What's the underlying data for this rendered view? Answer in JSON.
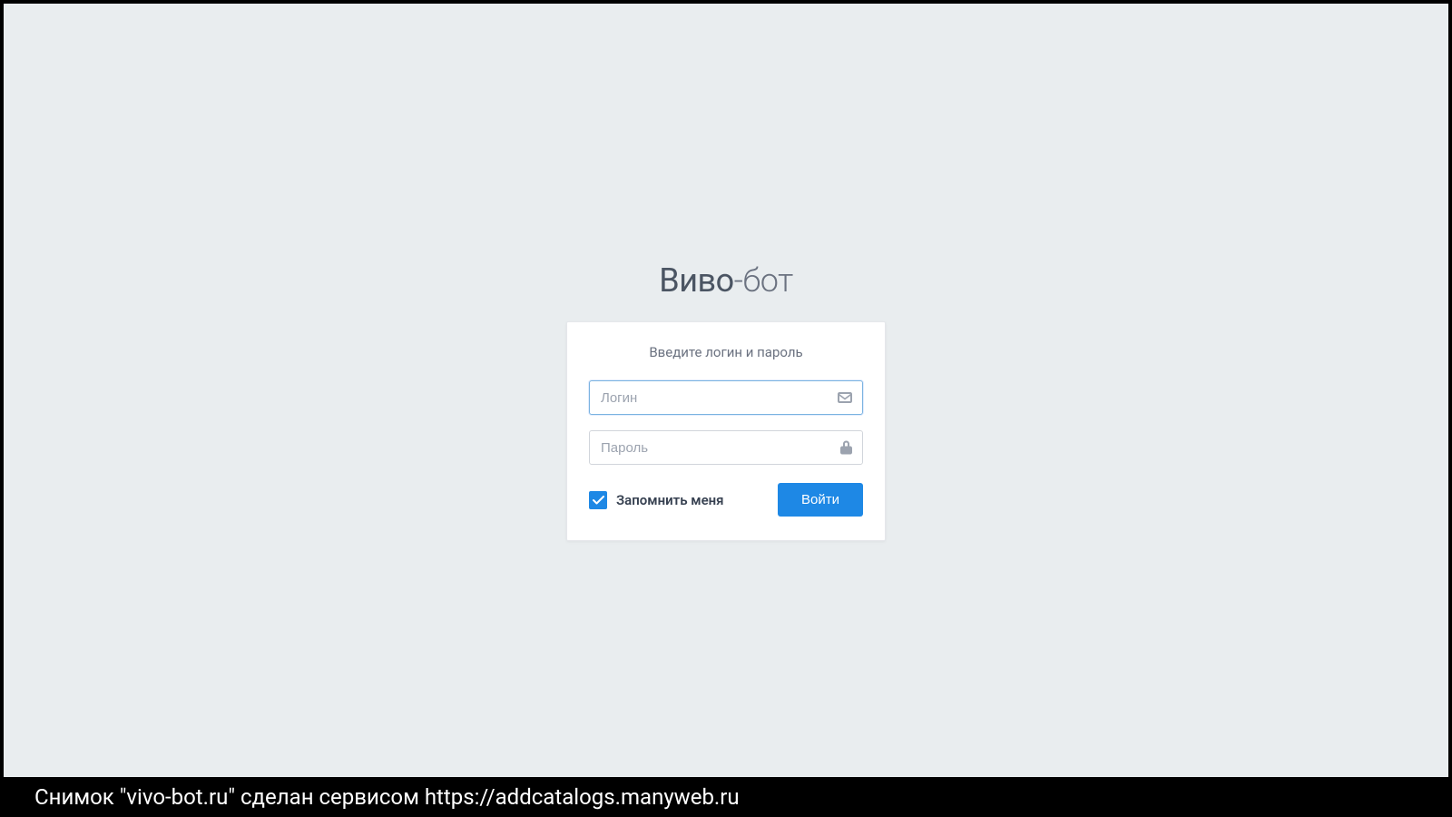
{
  "brand": {
    "part1": "Виво",
    "part2": "-бот"
  },
  "form": {
    "instruction": "Введите логин и пароль",
    "login_placeholder": "Логин",
    "login_value": "",
    "password_placeholder": "Пароль",
    "password_value": "",
    "remember_label": "Запомнить меня",
    "remember_checked": true,
    "submit_label": "Войти"
  },
  "caption": "Снимок \"vivo-bot.ru\" сделан сервисом https://addcatalogs.manyweb.ru"
}
